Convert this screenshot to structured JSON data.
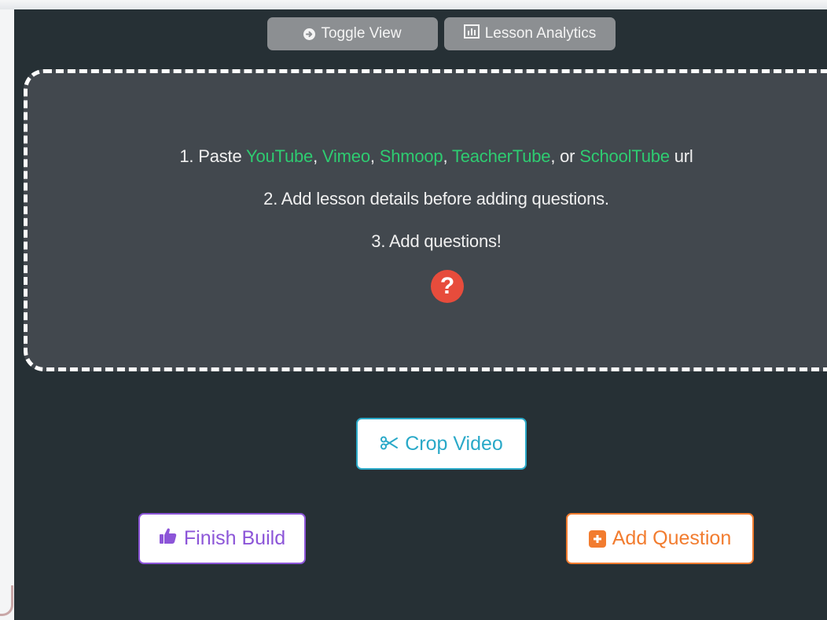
{
  "toolbar": {
    "toggle_view_label": "Toggle View",
    "lesson_analytics_label": "Lesson Analytics"
  },
  "instructions": {
    "step1_prefix": "1. Paste ",
    "providers": [
      "YouTube",
      "Vimeo",
      "Shmoop",
      "TeacherTube",
      "SchoolTube"
    ],
    "sep": ", ",
    "or_word": ", or ",
    "step1_suffix": " url",
    "step2": "2. Add lesson details before adding questions.",
    "step3": "3. Add questions!",
    "help_glyph": "?"
  },
  "actions": {
    "crop_video_label": "Crop Video",
    "finish_build_label": "Finish Build",
    "add_question_label": "Add Question"
  },
  "icons": {
    "toggle": "circle-arrow-right-icon",
    "analytics": "bar-chart-icon",
    "help": "question-circle-icon",
    "crop": "scissors-icon",
    "finish": "thumbs-up-icon",
    "add": "plus-square-icon"
  },
  "colors": {
    "panel_bg": "#263035",
    "dropzone_bg": "#42484e",
    "provider_link": "#2ecc71",
    "help_icon": "#e74c3c",
    "crop_accent": "#2aa9c8",
    "finish_accent": "#8c55d8",
    "add_accent": "#f27c2f"
  }
}
